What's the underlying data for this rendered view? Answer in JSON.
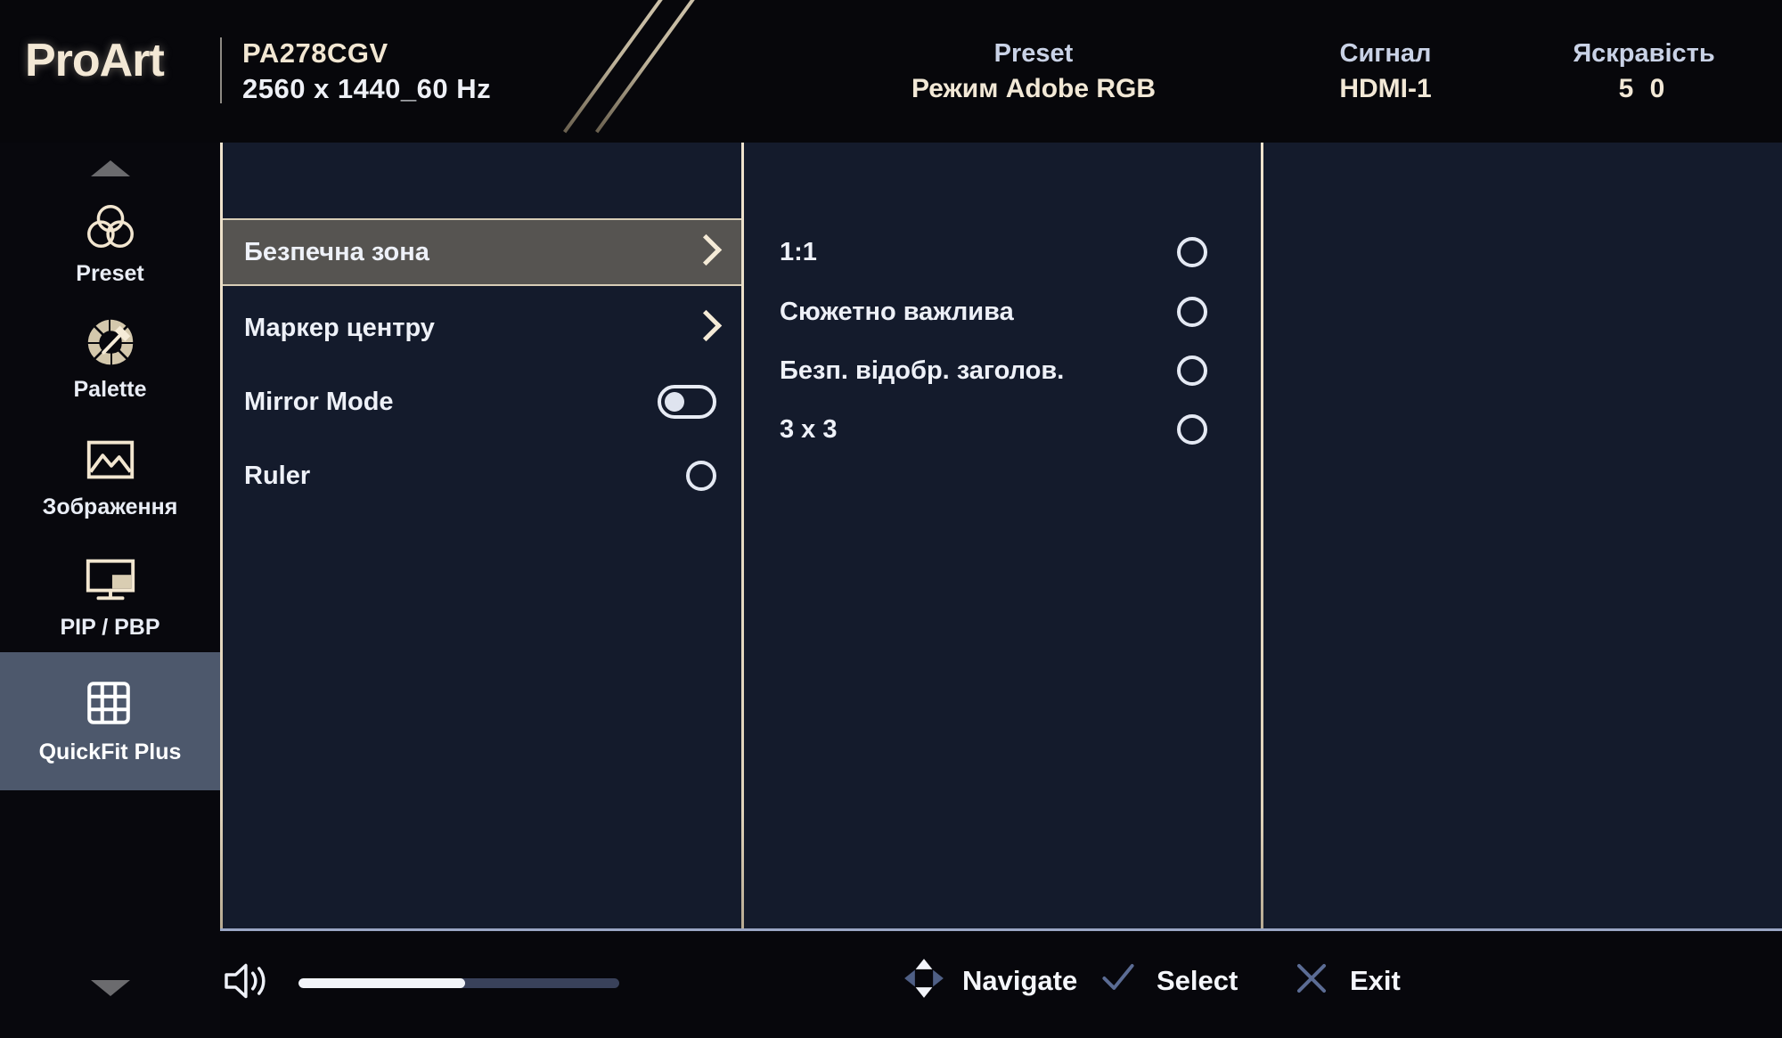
{
  "header": {
    "brand": "ProArt",
    "model": "PA278CGV",
    "resolution": "2560 x 1440_60 Hz",
    "preset_label": "Preset",
    "preset_value": "Режим Adobe RGB",
    "signal_label": "Сигнал",
    "signal_value": "HDMI-1",
    "brightness_label": "Яскравість",
    "brightness_value": "5 0",
    "accent_color": "#f0e4cd"
  },
  "sidebar": {
    "scroll_up_icon": "triangle-up-icon",
    "scroll_down_icon": "triangle-down-icon",
    "active_index": 4,
    "active_bg": "#4d586c",
    "items": [
      {
        "label": "Preset",
        "icon": "venn-circles-icon",
        "active": false
      },
      {
        "label": "Palette",
        "icon": "color-wheel-eyedropper-icon",
        "active": false
      },
      {
        "label": "Зображення",
        "icon": "picture-icon",
        "active": false
      },
      {
        "label": "PIP / PBP",
        "icon": "monitor-pip-icon",
        "active": false
      },
      {
        "label": "QuickFit Plus",
        "icon": "grid-3x3-icon",
        "active": true
      }
    ]
  },
  "menu": {
    "rows": [
      {
        "label": "Безпечна зона",
        "control": "chevron",
        "selected": true
      },
      {
        "label": "Маркер центру",
        "control": "chevron",
        "selected": false
      },
      {
        "label": "Mirror Mode",
        "control": "toggle",
        "toggle_state": "off",
        "selected": false
      },
      {
        "label": "Ruler",
        "control": "radio",
        "checked": false,
        "selected": false
      }
    ],
    "selected_bg": "#565451"
  },
  "options": {
    "items": [
      {
        "label": "1:1",
        "control": "radio",
        "checked": false
      },
      {
        "label": "Сюжетно важлива",
        "control": "radio",
        "checked": false
      },
      {
        "label": "Безп. відобр. заголов.",
        "control": "radio",
        "checked": false
      },
      {
        "label": "3 x 3",
        "control": "radio",
        "checked": false
      }
    ]
  },
  "footer": {
    "volume_icon": "speaker-volume-icon",
    "volume_percent": 52,
    "hints": [
      {
        "label": "Navigate",
        "icon": "dpad-diamond-icon"
      },
      {
        "label": "Select",
        "icon": "checkmark-icon"
      },
      {
        "label": "Exit",
        "icon": "close-x-icon"
      }
    ]
  }
}
